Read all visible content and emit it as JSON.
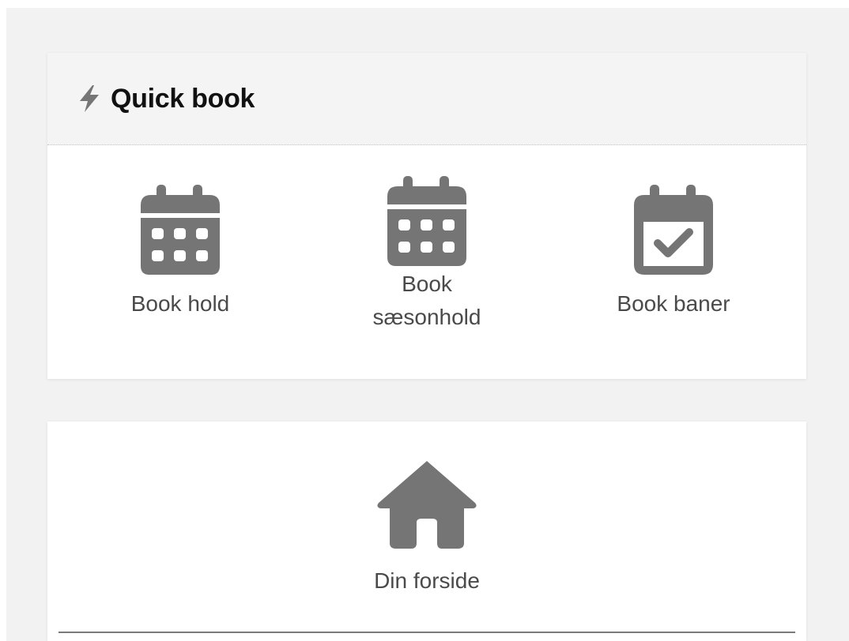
{
  "quick_book": {
    "title": "Quick book",
    "icon": "bolt-icon",
    "items": [
      {
        "label": "Book hold",
        "icon": "calendar-grid-icon"
      },
      {
        "label": "Book\nsæsonhold",
        "icon": "calendar-grid-icon"
      },
      {
        "label": "Book baner",
        "icon": "calendar-check-icon"
      }
    ]
  },
  "home": {
    "label": "Din forside",
    "icon": "home-icon"
  },
  "colors": {
    "icon": "#757575",
    "page_background": "#f2f2f2",
    "header_background": "#f4f4f4",
    "text": "#4a4a4a",
    "title": "#111111"
  }
}
